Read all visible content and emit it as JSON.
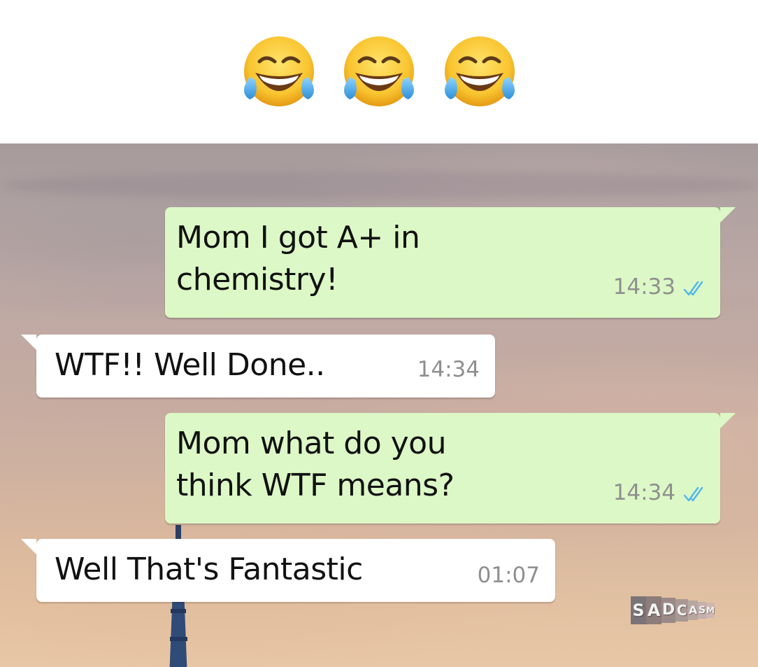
{
  "header": {
    "emojis": [
      "face-with-tears-of-joy-icon",
      "face-with-tears-of-joy-icon",
      "face-with-tears-of-joy-icon"
    ]
  },
  "chat": {
    "messages": [
      {
        "direction": "outgoing",
        "lines": [
          "Mom I got A+ in",
          "chemistry!"
        ],
        "time": "14:33",
        "status": "read-double-check-icon"
      },
      {
        "direction": "incoming",
        "lines": [
          "WTF!! Well Done.."
        ],
        "time": "14:34"
      },
      {
        "direction": "outgoing",
        "lines": [
          "Mom what do you",
          "think WTF means?"
        ],
        "time": "14:34",
        "status": "read-double-check-icon"
      },
      {
        "direction": "incoming",
        "lines": [
          "Well That's Fantastic"
        ],
        "time": "01:07"
      }
    ]
  },
  "watermark": {
    "text": "SADCASM"
  },
  "colors": {
    "outgoing_bubble": "#dcf8c6",
    "incoming_bubble": "#ffffff",
    "timestamp": "#8f8f8f",
    "read_ticks": "#4fb6ec"
  }
}
